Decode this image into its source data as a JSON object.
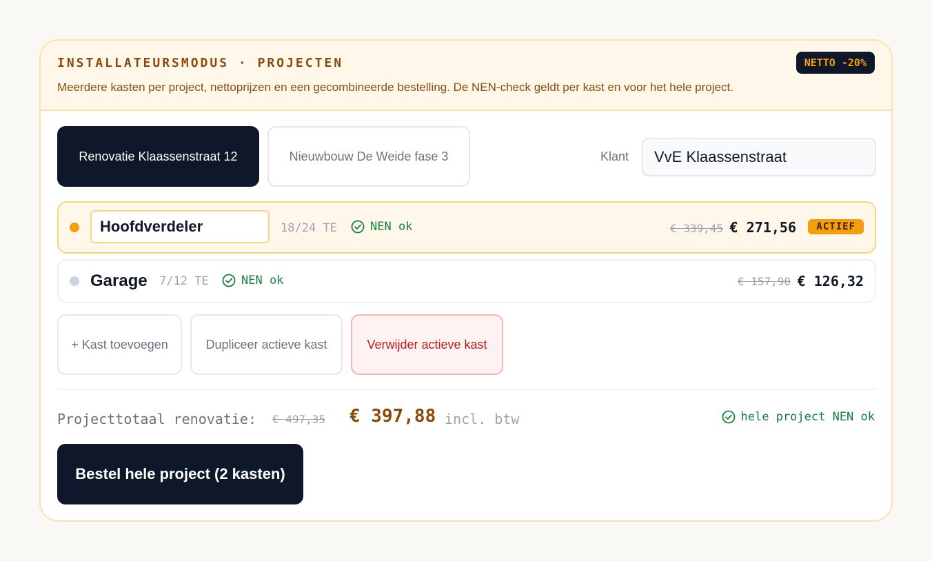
{
  "banner": {
    "title": "INSTALLATEURSMODUS · PROJECTEN",
    "description": "Meerdere kasten per project, nettoprijzen en een gecombineerde bestelling. De NEN-check geldt per kast en voor het hele project.",
    "badge": "NETTO -20%"
  },
  "projects": [
    {
      "label": "Renovatie Klaassenstraat 12",
      "active": true
    },
    {
      "label": "Nieuwbouw De Weide fase 3",
      "active": false
    }
  ],
  "client": {
    "label": "Klant",
    "value": "VvE Klaassenstraat"
  },
  "kasten": [
    {
      "name": "Hoofdverdeler",
      "te": "18/24 TE",
      "nen": "NEN ok",
      "old_price": "€ 339,45",
      "new_price": "€ 271,56",
      "badge": "ACTIEF"
    },
    {
      "name": "Garage",
      "te": "7/12 TE",
      "nen": "NEN ok",
      "old_price": "€ 157,90",
      "new_price": "€ 126,32"
    }
  ],
  "actions": {
    "add": "+ Kast toevoegen",
    "duplicate": "Dupliceer actieve kast",
    "delete": "Verwijder actieve kast"
  },
  "total": {
    "label": "Projecttotaal renovatie:",
    "old_price": "€ 497,35",
    "new_price": "€ 397,88",
    "suffix": "incl. btw",
    "nen": "hele project NEN ok"
  },
  "order_button": "Bestel hele project (2 kasten)",
  "colors": {
    "accent": "#f59e0b",
    "dark": "#0f172a",
    "ok_green": "#15803d",
    "danger": "#b91c1c",
    "brown": "#8b4c0a"
  },
  "icons": {
    "nen_status": "check-circle-icon"
  }
}
